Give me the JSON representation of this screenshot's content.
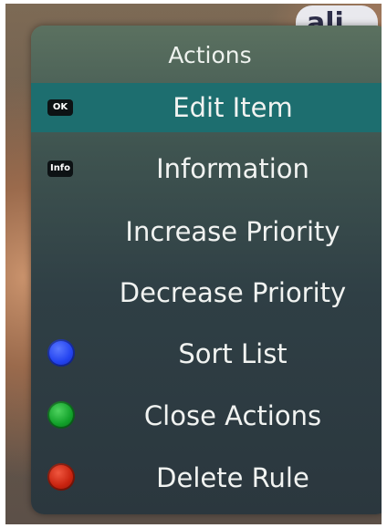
{
  "background": {
    "logo_text": "ali"
  },
  "menu": {
    "title": "Actions",
    "items": [
      {
        "label": "Edit Item",
        "key": "OK",
        "selected": true
      },
      {
        "label": "Information",
        "key": "Info"
      },
      {
        "label": "Increase Priority"
      },
      {
        "label": "Decrease Priority"
      },
      {
        "label": "Sort List",
        "color_key": "#2343f0"
      },
      {
        "label": "Close Actions",
        "color_key": "#12a12a"
      },
      {
        "label": "Delete Rule",
        "color_key": "#c8230f"
      }
    ]
  },
  "colors": {
    "selected_highlight": "#1d6e6f",
    "blue_key": "#2343f0",
    "green_key": "#12a12a",
    "red_key": "#c8230f"
  }
}
